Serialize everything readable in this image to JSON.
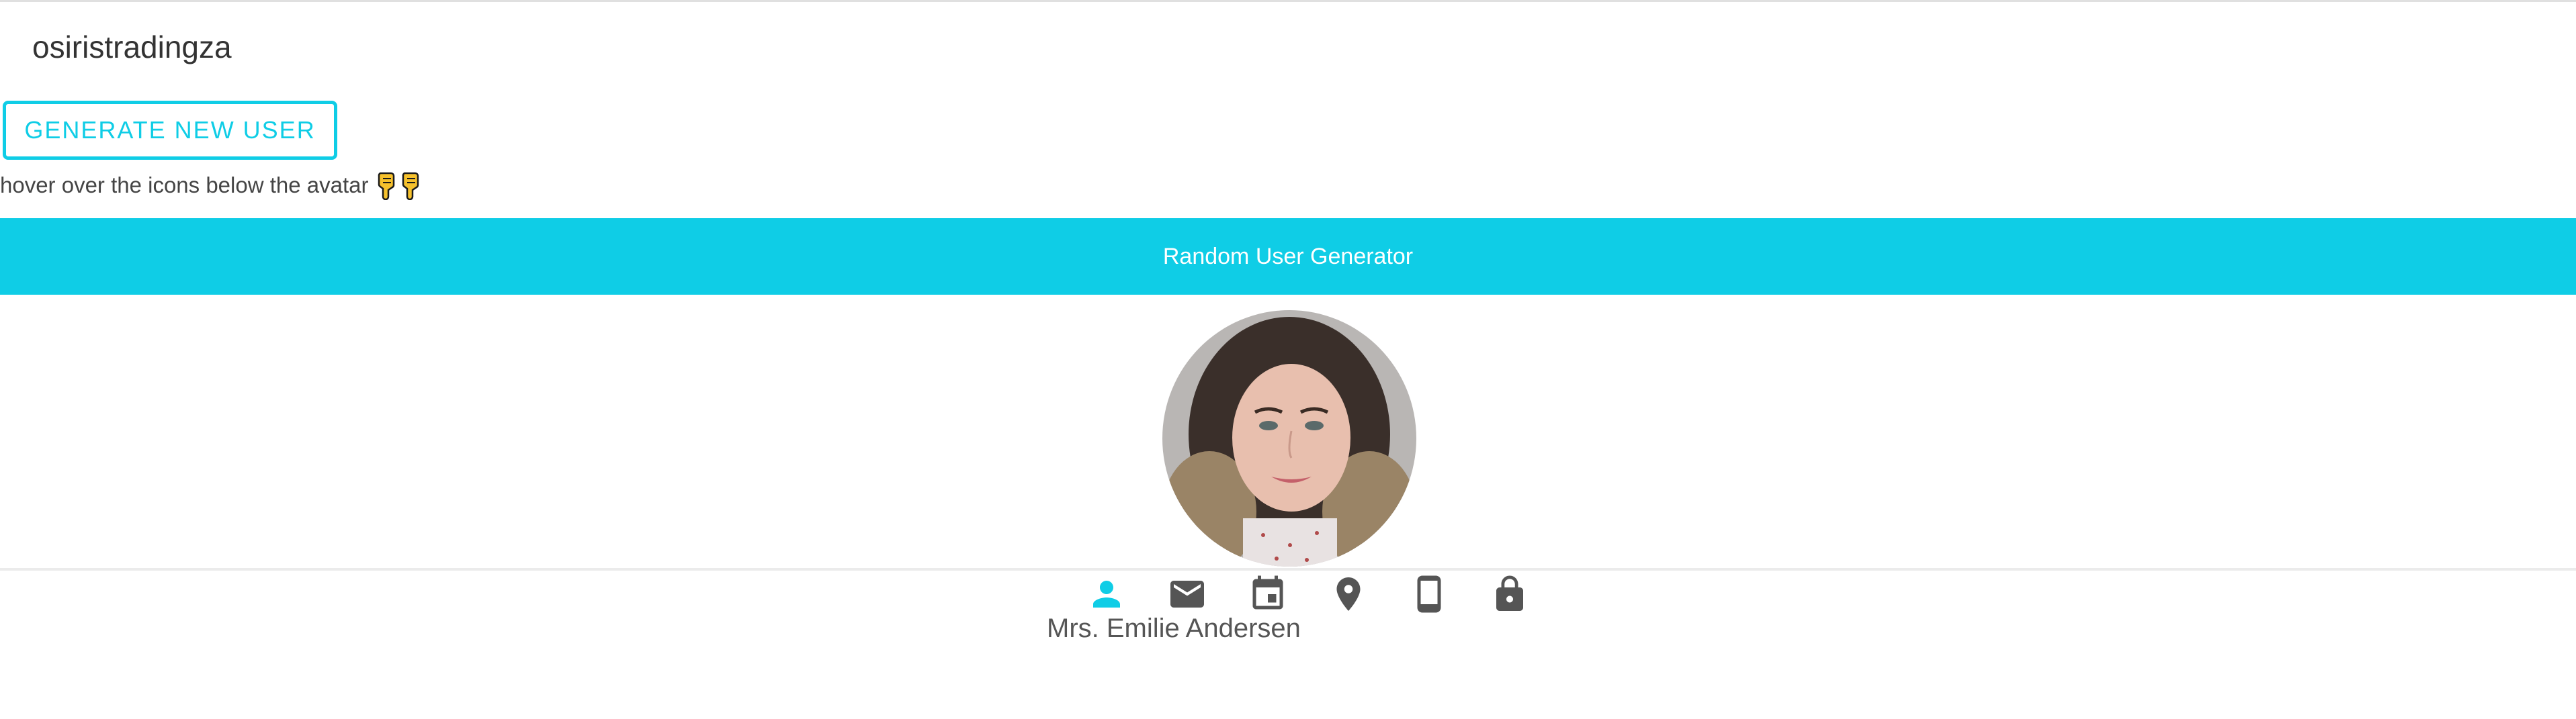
{
  "header": {
    "brand": "osiristradingza"
  },
  "actions": {
    "generate_label": "GENERATE NEW USER"
  },
  "hint": {
    "text": "hover over the icons below the avatar",
    "emoji": [
      "pointing-down-hand-icon",
      "pointing-down-hand-icon"
    ]
  },
  "banner": {
    "title": "Random User Generator"
  },
  "user": {
    "name": "Mrs. Emilie Andersen"
  },
  "icons": [
    {
      "name": "person-icon",
      "active": true
    },
    {
      "name": "envelope-icon",
      "active": false
    },
    {
      "name": "calendar-icon",
      "active": false
    },
    {
      "name": "location-pin-icon",
      "active": false
    },
    {
      "name": "phone-icon",
      "active": false
    },
    {
      "name": "lock-icon",
      "active": false
    }
  ],
  "colors": {
    "accent": "#0fcde6",
    "icon_default": "#555555",
    "icon_active": "#0fcde6",
    "text": "#555555"
  }
}
